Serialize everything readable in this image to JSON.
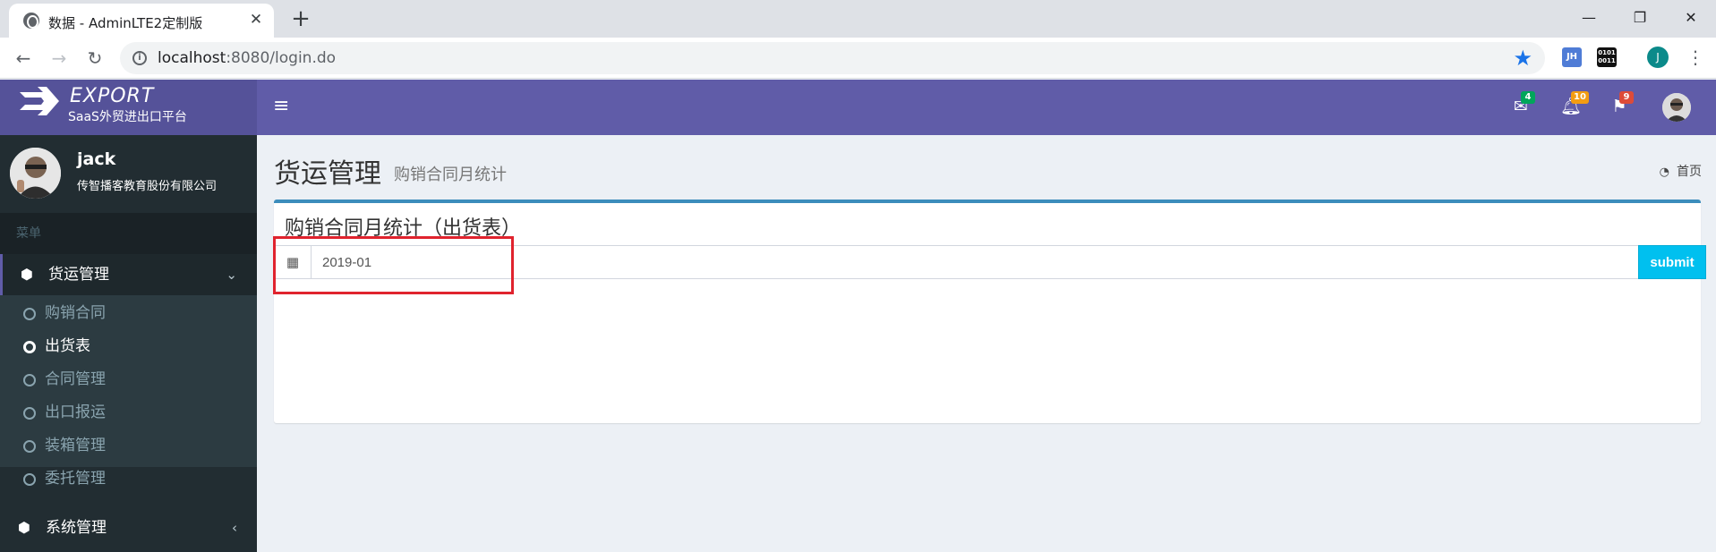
{
  "browser": {
    "tab_title": "数据 - AdminLTE2定制版",
    "tab_close": "✕",
    "new_tab": "+",
    "url_host": "localhost",
    "url_rest": ":8080/login.do",
    "ext_jh": "JH",
    "ext_bin": "0101 0011",
    "account_initial": "J",
    "window_minimize": "—",
    "window_restore": "❐",
    "window_close": "✕"
  },
  "logo": {
    "title": "EXPORT",
    "subtitle": "SaaS外贸进出口平台"
  },
  "topnav": {
    "mail_count": "4",
    "bell_count": "10",
    "flag_count": "9",
    "colors": {
      "mail_badge": "#00a65a",
      "bell_badge": "#f39c12",
      "flag_badge": "#dd4b39"
    }
  },
  "user": {
    "name": "jack",
    "company": "传智播客教育股份有限公司"
  },
  "sidebar": {
    "header": "菜单",
    "groups": [
      {
        "label": "货运管理",
        "icon": "cube-icon",
        "expanded": true
      },
      {
        "label": "系统管理",
        "icon": "cube-icon",
        "expanded": false
      }
    ],
    "items": [
      {
        "label": "购销合同",
        "active": false
      },
      {
        "label": "出货表",
        "active": true
      },
      {
        "label": "合同管理",
        "active": false
      },
      {
        "label": "出口报运",
        "active": false
      },
      {
        "label": "装箱管理",
        "active": false
      },
      {
        "label": "委托管理",
        "active": false
      }
    ]
  },
  "content": {
    "title": "货运管理",
    "subtitle": "购销合同月统计",
    "breadcrumb": "首页",
    "box_title": "购销合同月统计（出货表）",
    "date_value": "2019-01",
    "submit_label": "submit"
  }
}
